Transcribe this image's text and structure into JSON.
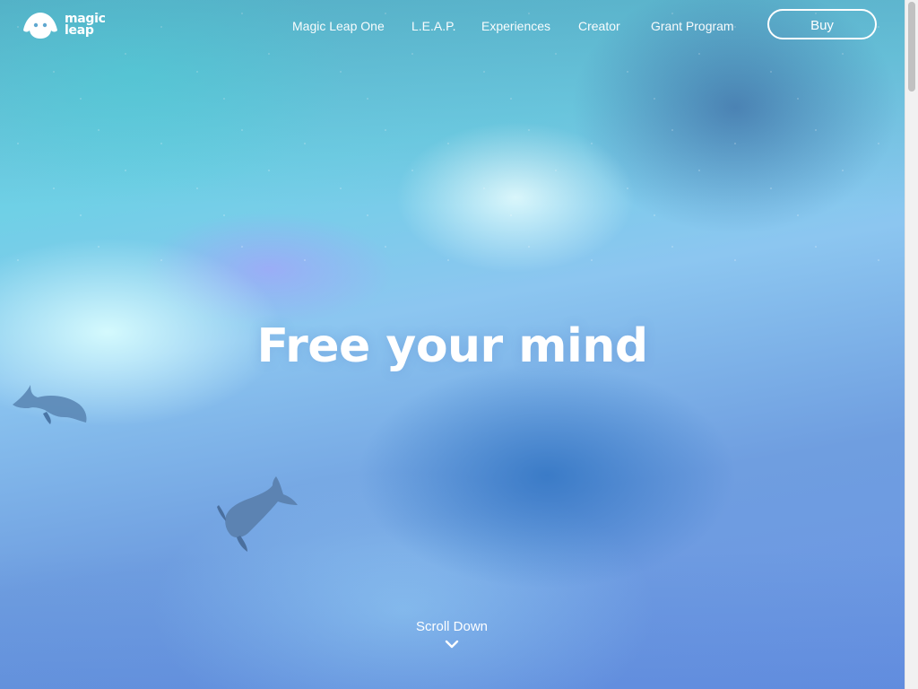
{
  "brand": {
    "line1": "magic",
    "line2": "leap"
  },
  "nav": {
    "links": [
      {
        "label": "Magic Leap One"
      },
      {
        "label": "L.E.A.P."
      },
      {
        "label": "Experiences"
      },
      {
        "label": "Creator"
      },
      {
        "label": "Grant Program"
      }
    ],
    "buy_label": "Buy"
  },
  "hero": {
    "headline": "Free your mind",
    "scroll_label": "Scroll Down"
  },
  "icons": {
    "logo": "magic-leap-logo-icon",
    "scroll": "chevron-down-icon"
  },
  "colors": {
    "text": "#ffffff",
    "sky_light": "#8fe6ee",
    "sky_deep": "#6b95e4"
  }
}
